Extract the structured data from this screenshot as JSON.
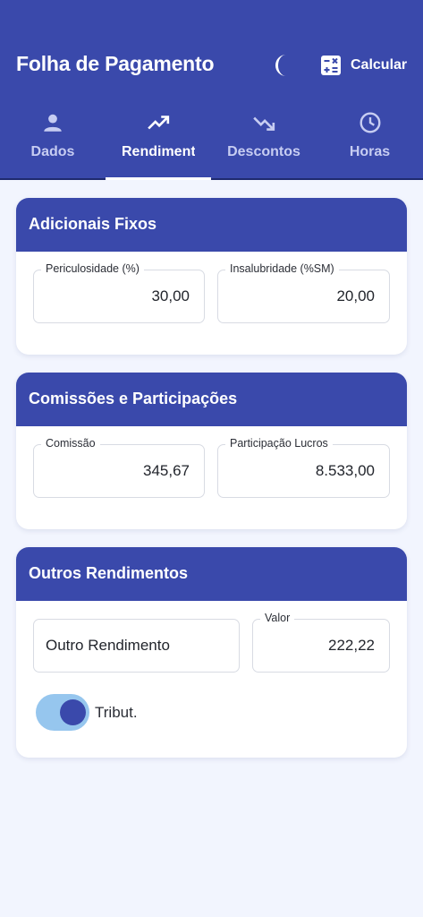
{
  "header": {
    "title": "Folha de Pagamento",
    "calculate_label": "Calcular"
  },
  "tabs": [
    {
      "label": "Dados",
      "icon": "person-icon",
      "active": false
    },
    {
      "label": "Rendimentos",
      "icon": "trending-up-icon",
      "active": true
    },
    {
      "label": "Descontos",
      "icon": "trending-down-icon",
      "active": false
    },
    {
      "label": "Horas",
      "icon": "clock-icon",
      "active": false
    }
  ],
  "cards": {
    "adicionais": {
      "title": "Adicionais Fixos",
      "fields": [
        {
          "label": "Periculosidade (%)",
          "value": "30,00"
        },
        {
          "label": "Insalubridade (%SM)",
          "value": "20,00"
        }
      ]
    },
    "comissoes": {
      "title": "Comissões e Participações",
      "fields": [
        {
          "label": "Comissão",
          "value": "345,67"
        },
        {
          "label": "Participação Lucros",
          "value": "8.533,00"
        }
      ]
    },
    "outros": {
      "title": "Outros Rendimentos",
      "description_value": "Outro Rendimento",
      "value_label": "Valor",
      "value": "222,22",
      "toggle_label": "Tribut.",
      "toggle_on": true
    }
  },
  "colors": {
    "primary": "#3a49ab",
    "background": "#f2f5fe",
    "toggle_track": "#96c6ee"
  }
}
